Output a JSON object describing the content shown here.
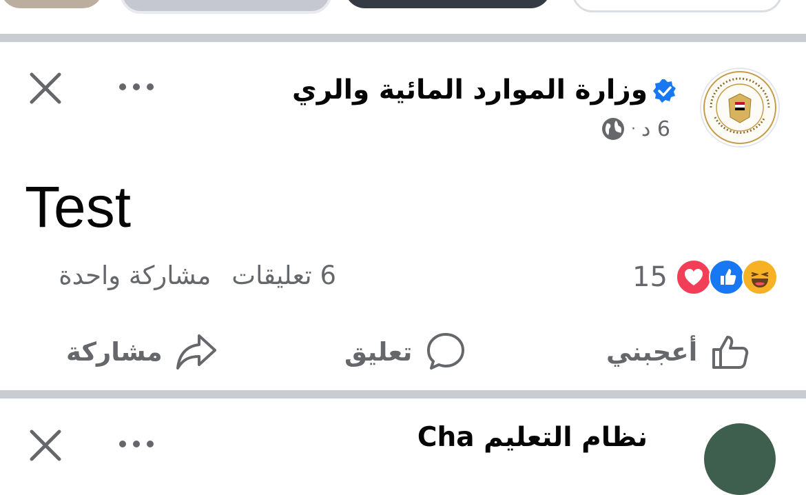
{
  "post": {
    "page_name": "وزارة  الموارد  المائية  والري",
    "meta": {
      "time": "6 د",
      "separator": "·"
    },
    "text": "Test",
    "reactions": {
      "count": "15",
      "types": [
        "love-icon",
        "like-icon",
        "haha-icon"
      ]
    },
    "comments_text": "6 تعليقات",
    "shares_text": "مشاركة واحدة",
    "actions": {
      "like": "أعجبني",
      "comment": "تعليق",
      "share": "مشاركة"
    }
  },
  "next_post": {
    "page_name_partial": "نظام التعليم  Cha"
  },
  "colors": {
    "secondary_text": "#65676b",
    "separator": "#c9ccd1",
    "verified_blue": "#1877f2",
    "love_red": "#f33e58",
    "haha_yellow": "#f7b125"
  }
}
